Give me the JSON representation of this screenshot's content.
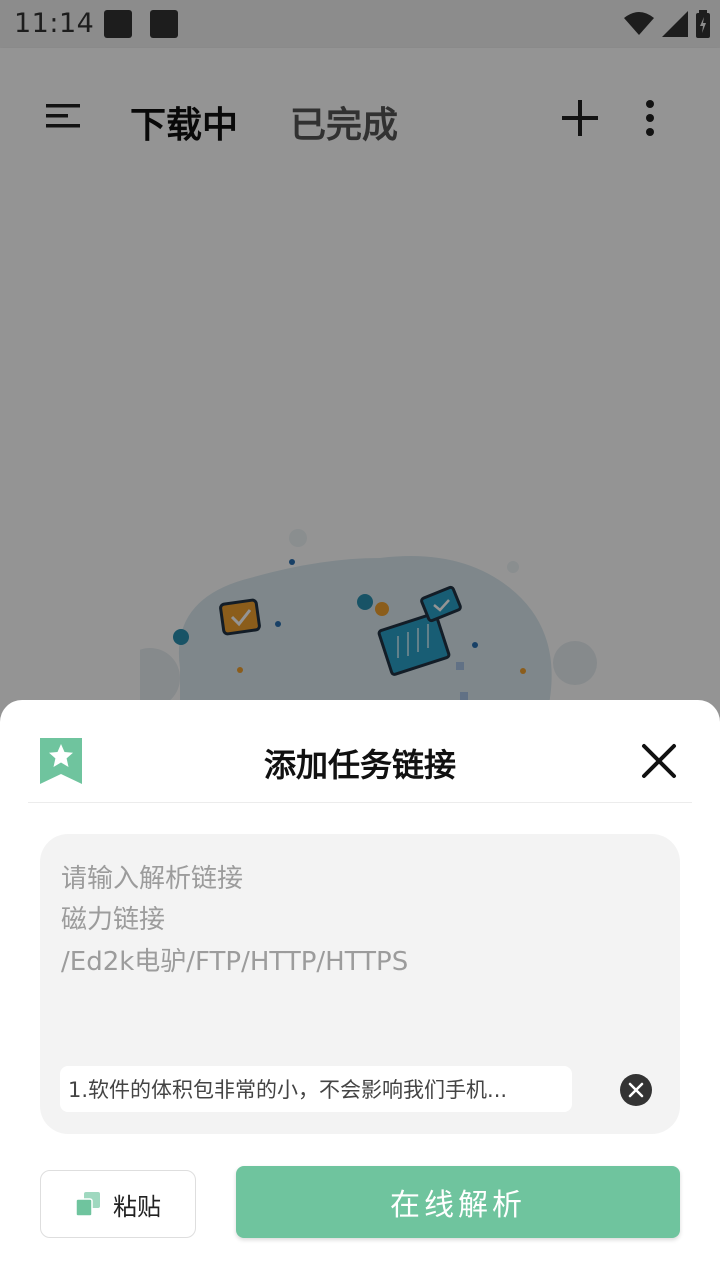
{
  "status_bar": {
    "time": "11:14"
  },
  "app_bar": {
    "tabs": [
      {
        "label": "下载中",
        "active": true
      },
      {
        "label": "已完成",
        "active": false
      }
    ],
    "icons": [
      "menu-icon",
      "add-icon",
      "more-vert-icon"
    ]
  },
  "dialog": {
    "title": "添加任务链接",
    "input": {
      "placeholder_lines": [
        "请输入解析链接",
        "磁力链接",
        "/Ed2k电驴/FTP/HTTP/HTTPS"
      ],
      "suggestion": "1.软件的体积包非常的小，不会影响我们手机..."
    },
    "paste_label": "粘贴",
    "parse_label": "在线解析"
  },
  "colors": {
    "accent": "#6fc49e",
    "scrim": "rgba(0,0,0,0.42)"
  }
}
